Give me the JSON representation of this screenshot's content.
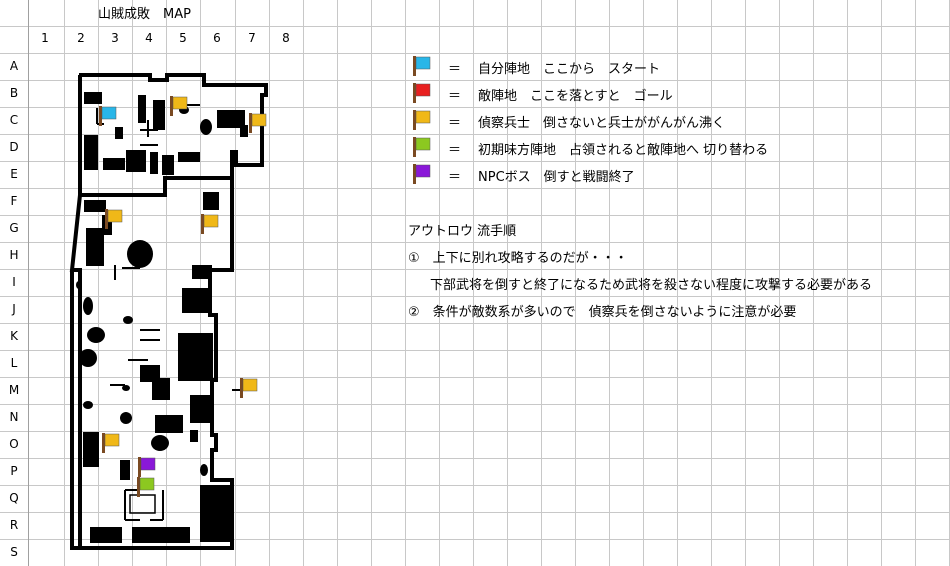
{
  "sheet": {
    "title": "山賊成敗　MAP",
    "columns": [
      "1",
      "2",
      "3",
      "4",
      "5",
      "6",
      "7",
      "8"
    ],
    "rows": [
      "A",
      "B",
      "C",
      "D",
      "E",
      "F",
      "G",
      "H",
      "I",
      "J",
      "K",
      "L",
      "M",
      "N",
      "O",
      "P",
      "Q",
      "R",
      "S"
    ]
  },
  "legend": [
    {
      "flag_color": "#29b6e8",
      "eq": "＝",
      "text": "自分陣地　ここから　スタート"
    },
    {
      "flag_color": "#e82020",
      "eq": "＝",
      "text": "敵陣地　ここを落とすと　ゴール"
    },
    {
      "flag_color": "#f0b818",
      "eq": "＝",
      "text": "偵察兵士　倒さないと兵士ががんがん沸く"
    },
    {
      "flag_color": "#8cc820",
      "eq": "＝",
      "text": "初期味方陣地　占領されると敵陣地へ 切り替わる"
    },
    {
      "flag_color": "#8a18d8",
      "eq": "＝",
      "text": "NPCボス　倒すと戦闘終了"
    }
  ],
  "notes": {
    "heading": "アウトロウ 流手順",
    "item1": "①　上下に別れ攻略するのだが・・・",
    "item1_sub": "下部武将を倒すと終了になるため武将を殺さない程度に攻撃する必要がある",
    "item2": "②　条件が敵数系が多いので　偵察兵を倒さないように注意が必要"
  },
  "map_flags": [
    {
      "color": "#29b6e8",
      "name": "start-flag"
    },
    {
      "color": "#f0b818",
      "name": "scout-flag"
    },
    {
      "color": "#8a18d8",
      "name": "boss-flag"
    },
    {
      "color": "#8cc820",
      "name": "ally-flag"
    }
  ]
}
